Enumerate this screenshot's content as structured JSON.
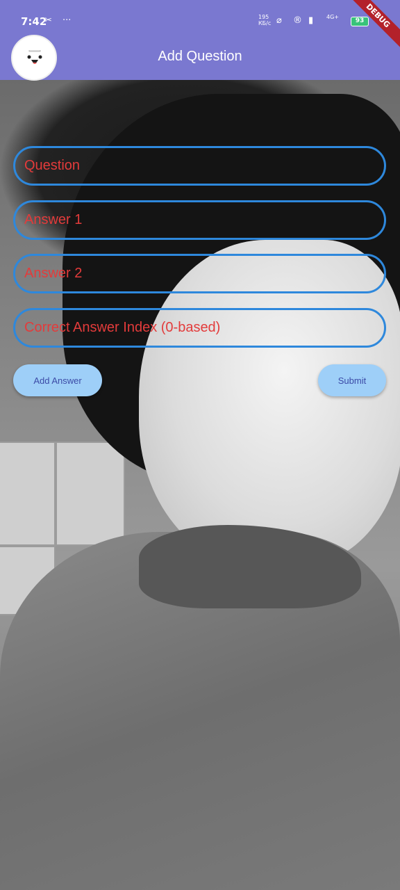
{
  "status_bar": {
    "time": "7:42",
    "net_speed_value": "195",
    "net_speed_unit": "КБ/с",
    "signal_label": "4G+",
    "battery": "93"
  },
  "debug_banner": "DEBUG",
  "app_bar": {
    "title": "Add Question"
  },
  "form": {
    "question_placeholder": "Question",
    "answer1_placeholder": "Answer 1",
    "answer2_placeholder": "Answer 2",
    "correct_index_placeholder": "Correct Answer Index (0-based)"
  },
  "actions": {
    "add_answer_label": "Add Answer",
    "submit_label": "Submit"
  },
  "colors": {
    "app_bar": "#7a78d0",
    "field_border": "#2e88dc",
    "placeholder_text": "#e33b3b",
    "button_bg": "#9ecff8"
  }
}
